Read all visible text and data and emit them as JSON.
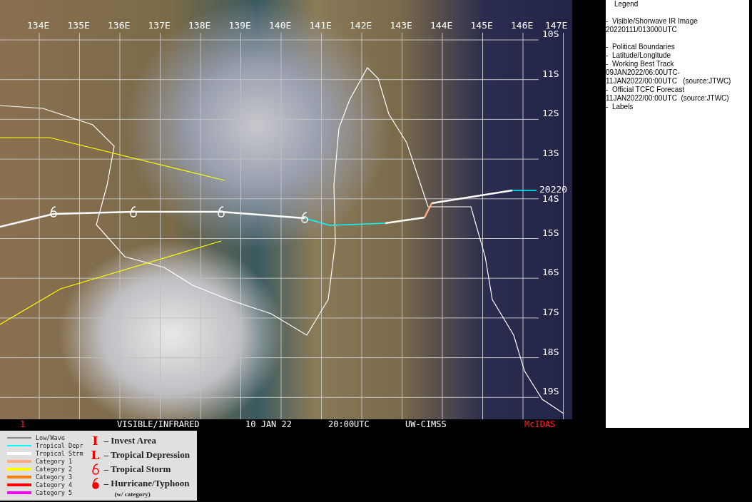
{
  "map": {
    "lon_labels": [
      "134E",
      "135E",
      "136E",
      "137E",
      "138E",
      "139E",
      "140E",
      "141E",
      "142E",
      "143E",
      "144E",
      "145E",
      "146E",
      "147E"
    ],
    "lat_labels": [
      "10S",
      "11S",
      "12S",
      "13S",
      "14S",
      "15S",
      "16S",
      "17S",
      "18S",
      "19S"
    ],
    "track_label": "20220"
  },
  "status_strip": {
    "frame": "1",
    "product": "VISIBLE/INFRARED",
    "date": "10 JAN 22",
    "time": "20:00UTC",
    "source": "UW-CIMSS",
    "brand": "McIDAS"
  },
  "track_legend": [
    {
      "name": "Low/Wave",
      "color": "#888888"
    },
    {
      "name": "Tropical Depr",
      "color": "#00ffff"
    },
    {
      "name": "Tropical Strm",
      "color": "#ffffff"
    },
    {
      "name": "Category 1",
      "color": "#ffaa80"
    },
    {
      "name": "Category 2",
      "color": "#ffff00"
    },
    {
      "name": "Category 3",
      "color": "#ff8000"
    },
    {
      "name": "Category 4",
      "color": "#ff0000"
    },
    {
      "name": "Category 5",
      "color": "#ff00ff"
    }
  ],
  "symbol_legend": [
    {
      "kind": "letter",
      "symbol": "I",
      "label": "– Invest Area"
    },
    {
      "kind": "letter",
      "symbol": "L",
      "label": "– Tropical Depression"
    },
    {
      "kind": "storm",
      "label": "– Tropical Storm"
    },
    {
      "kind": "hurricane",
      "label": "– Hurricane/Typhoon",
      "note": "(w/ category)"
    }
  ],
  "side_legend": [
    [
      "Legend"
    ],
    [
      "-  Visible/Shorwave IR Image",
      "20220111/013000UTC"
    ],
    [
      "-  Political Boundaries",
      "-  Latitude/Longitude",
      "-  Working Best Track",
      "09JAN2022/06:00UTC-",
      "11JAN2022/00:00UTC   (source:JTWC)",
      "-  Official TCFC Forecast",
      "11JAN2022/00:00UTC  (source:JTWC)",
      "-  Labels"
    ]
  ]
}
